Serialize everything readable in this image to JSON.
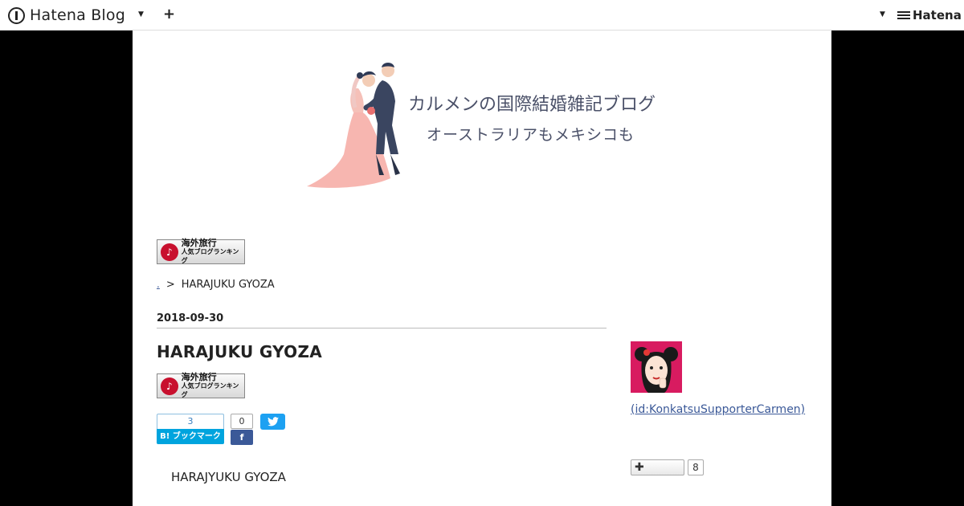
{
  "topbar": {
    "logo_text": "Hatena Blog",
    "hatena_text": "Hatena"
  },
  "header": {
    "blog_title": "カルメンの国際結婚雑記ブログ",
    "blog_subtitle": "オーストラリアもメキシコも"
  },
  "ranking_banner": {
    "line1": "海外旅行",
    "line2": "人気ブログランキング"
  },
  "breadcrumb": {
    "home": ".",
    "separator": ">",
    "current": "HARAJUKU GYOZA"
  },
  "entry": {
    "date": "2018-09-30",
    "title": "HARAJUKU GYOZA",
    "body_text": "HARAJYUKU GYOZA"
  },
  "social": {
    "hatena_bookmark_count": "3",
    "hatena_bookmark_label": "B! ブックマーク",
    "facebook_count": "0",
    "facebook_label": "f"
  },
  "sidebar": {
    "profile_id": "(id:KonkatsuSupporterCarmen)",
    "follow_count": "8"
  },
  "colors": {
    "page_background": "#000000",
    "content_background": "#ffffff",
    "hatena_bookmark": "#00a4de",
    "facebook": "#3b5998",
    "twitter": "#1da1f2",
    "title_text": "#4a5068",
    "avatar_bg": "#d81b60"
  }
}
